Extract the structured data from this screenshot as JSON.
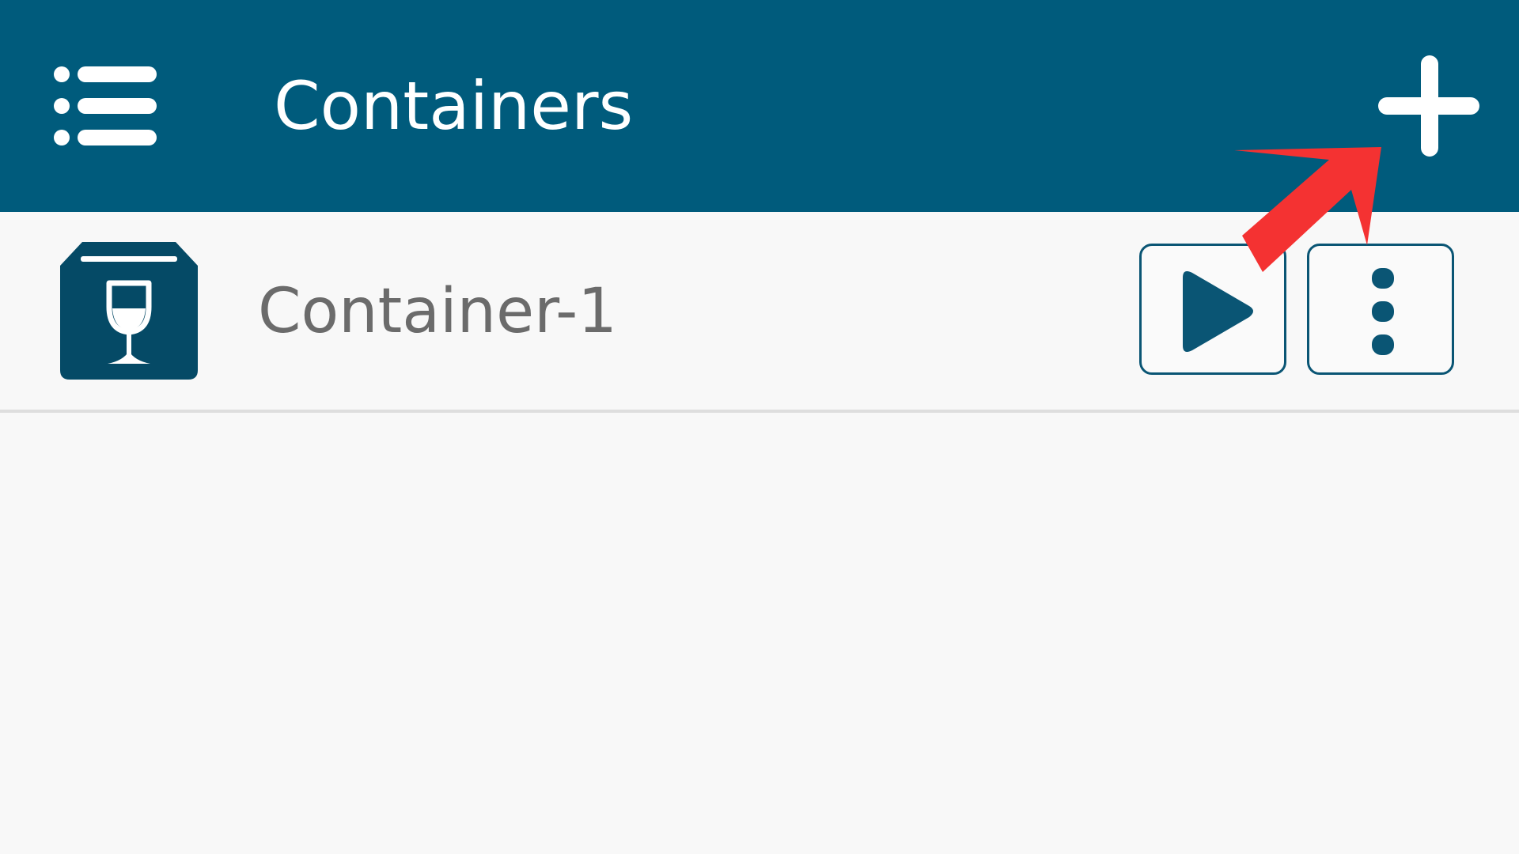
{
  "app_bar": {
    "title": "Containers",
    "menu_icon": "menu-list-icon",
    "add_icon": "plus-icon",
    "background_color": "#005b7c"
  },
  "containers": [
    {
      "name": "Container-1",
      "icon": "wine-glass-container-icon",
      "actions": {
        "start_icon": "play-icon",
        "more_icon": "more-vertical-icon"
      }
    }
  ],
  "annotation": {
    "type": "red-arrow",
    "color": "#f43232",
    "points_to": "add-container-button"
  }
}
